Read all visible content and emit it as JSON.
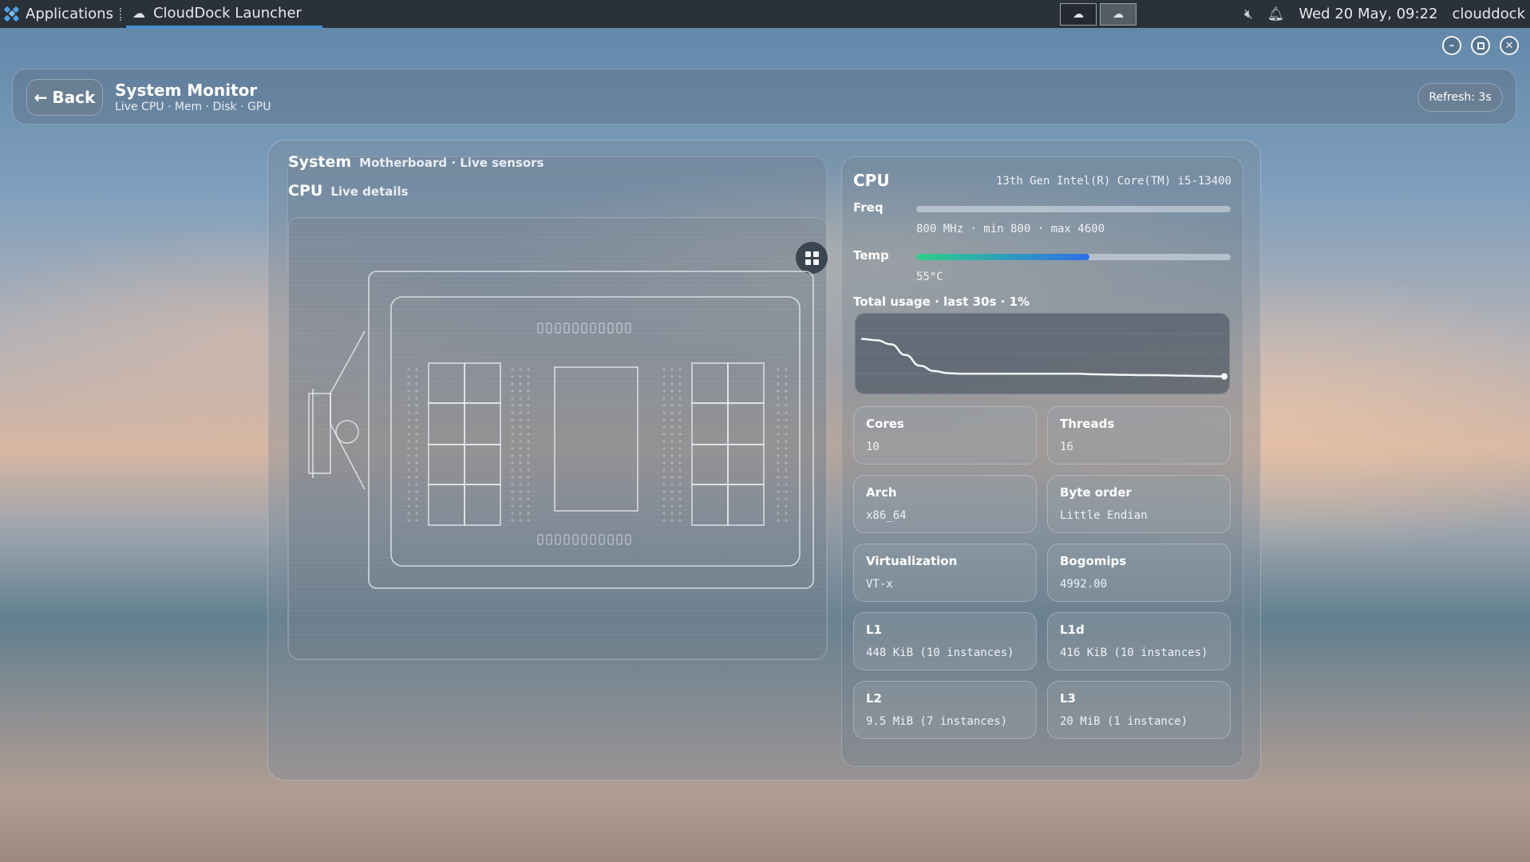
{
  "taskbar": {
    "applications_label": "Applications",
    "active_task": "CloudDock Launcher",
    "clock": "Wed 20 May, 09:22",
    "hostname": "clouddock"
  },
  "header": {
    "back_label": "Back",
    "title": "System Monitor",
    "subtitle": "Live CPU · Mem · Disk · GPU",
    "refresh_label": "Refresh: 3s"
  },
  "left_panel": {
    "system_title": "System",
    "system_sub": "Motherboard · Live sensors",
    "cpu_title": "CPU",
    "cpu_sub": "Live details"
  },
  "cpu": {
    "title": "CPU",
    "model": "13th Gen Intel(R) Core(TM) i5-13400",
    "freq_label": "Freq",
    "freq_text": "800 MHz · min 800 · max 4600",
    "freq_fraction": 0.0,
    "temp_label": "Temp",
    "temp_text": "55°C",
    "temp_fraction": 0.55,
    "usage_label": "Total usage · last 30s · 1%",
    "usage_history": [
      15,
      14.5,
      13,
      9,
      5,
      3,
      2.2,
      2,
      2,
      2,
      2,
      2,
      2,
      2,
      2,
      2,
      1.8,
      1.7,
      1.6,
      1.5,
      1.5,
      1.4,
      1.3,
      1.2,
      1.1,
      1.0
    ]
  },
  "tiles": [
    {
      "label": "Cores",
      "value": "10"
    },
    {
      "label": "Threads",
      "value": "16"
    },
    {
      "label": "Arch",
      "value": "x86_64"
    },
    {
      "label": "Byte order",
      "value": "Little Endian"
    },
    {
      "label": "Virtualization",
      "value": "VT-x"
    },
    {
      "label": "Bogomips",
      "value": "4992.00"
    },
    {
      "label": "L1",
      "value": "448 KiB (10 instances)"
    },
    {
      "label": "L1d",
      "value": "416 KiB (10 instances)"
    },
    {
      "label": "L2",
      "value": "9.5 MiB (7 instances)"
    },
    {
      "label": "L3",
      "value": "20 MiB (1 instance)"
    }
  ],
  "colors": {
    "accent": "#3d8fd6",
    "temp_gradient_start": "#2fcf8a",
    "temp_gradient_end": "#2f6fe8"
  },
  "icons": {
    "back": "arrow-left-icon",
    "grid": "grid-icon",
    "mute": "mute-icon",
    "bell": "bell-icon"
  }
}
